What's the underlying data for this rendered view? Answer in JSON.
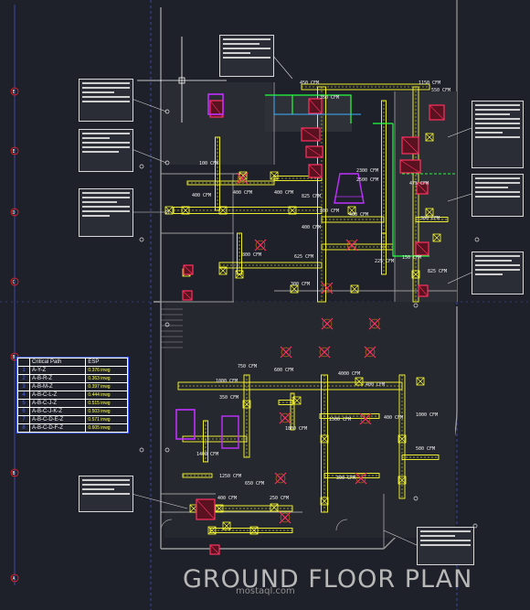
{
  "drawing": {
    "title": "GROUND FLOOR PLAN",
    "watermark": "mostaql.com",
    "colors": {
      "background": "#1e2129",
      "duct": "#ffff30",
      "equipment": "#ff3060",
      "pipe": "#20ff40",
      "accent": "#c030ff",
      "grid": "#5060ff",
      "wall": "#9a9a9a"
    }
  },
  "grid_labels": [
    "E",
    "E",
    "D",
    "C",
    "B",
    "B",
    "A"
  ],
  "critical_path_table": {
    "headers": [
      "Critical Path",
      "ESP"
    ],
    "rows": [
      {
        "n": "1",
        "path": "A-Y-Z",
        "esp": "0.376 inwg"
      },
      {
        "n": "2",
        "path": "A-B-R-Z",
        "esp": "0.363 inwg"
      },
      {
        "n": "3",
        "path": "A-B-M-Z",
        "esp": "0.397 inwg"
      },
      {
        "n": "4",
        "path": "A-B-C-L-Z",
        "esp": "0.444 inwg"
      },
      {
        "n": "5",
        "path": "A-B-C-J-Z",
        "esp": "0.515 inwg"
      },
      {
        "n": "6",
        "path": "A-B-C-J-K-Z",
        "esp": "0.503 inwg"
      },
      {
        "n": "7",
        "path": "A-B-C-D-E-Z",
        "esp": "0.571 inwg"
      },
      {
        "n": "8",
        "path": "A-B-C-D-F-Z",
        "esp": "0.605 inwg"
      }
    ]
  },
  "duct_labels": [
    "450 CFM",
    "350 CFM",
    "1150 CFM",
    "550 CFM",
    "100 CFM",
    "400 CFM",
    "400 CFM",
    "400 CFM",
    "825 CFM",
    "2300 CFM",
    "2500 CFM",
    "475 CFM",
    "300 CFM",
    "400 CFM",
    "400 CFM",
    "300 CFM",
    "825 CFM",
    "225 CFM",
    "625 CFM",
    "300 CFM",
    "150 CFM",
    "800 CFM",
    "750 CFM",
    "600 CFM",
    "4000 CFM",
    "400 CFM",
    "1000 CFM",
    "350 CFM",
    "1800 CFM",
    "1500 CFM",
    "1000 CFM",
    "400 CFM",
    "300 CFM",
    "1250 CFM",
    "650 CFM",
    "400 CFM",
    "250 CFM",
    "500 CFM",
    "1400 CFM"
  ]
}
